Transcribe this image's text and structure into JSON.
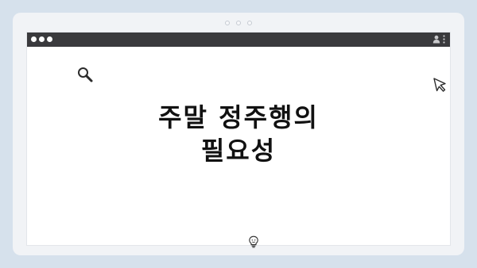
{
  "headline": {
    "line1": "주말 정주행의",
    "line2": "필요성"
  },
  "carousel": {
    "dot_count": 3
  },
  "icons": {
    "search": "search-icon",
    "cursor": "cursor-arrow-icon",
    "lightbulb": "lightbulb-icon",
    "user": "user-icon",
    "menu": "kebab-menu-icon"
  },
  "colors": {
    "background": "#d6e1ec",
    "card": "#f1f3f6",
    "title_bar": "#3a3a3d",
    "text": "#111111"
  }
}
